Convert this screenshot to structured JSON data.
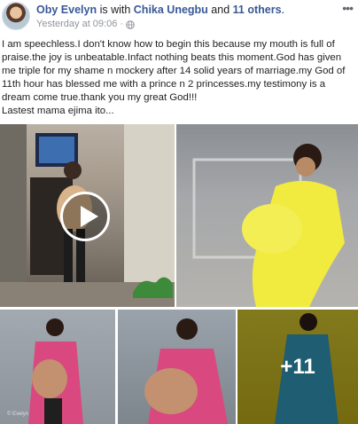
{
  "post": {
    "author": "Oby Evelyn",
    "with_text": " is with ",
    "tagged_name": "Chika Unegbu",
    "and_text": " and ",
    "others_text": "11 others",
    "period": ".",
    "timestamp": "Yesterday at 09:06",
    "dot": "·",
    "more_menu": "•••",
    "body_lines": [
      "I am speechless.I don't know how to begin this because my mouth is full of praise.the joy is unbeatable.Infact nothing beats this moment.God has given me triple for my shame n mockery after 14 solid years of marriage.my God of 11th hour has blessed me with a prince n 2 princesses.my testimony is a dream come true.thank you my great God!!!",
      "Lastest mama ejima ito..."
    ]
  },
  "media": {
    "more_count": "+11",
    "watermark": "© Evelyn"
  },
  "icons": {
    "globe": "globe-icon",
    "play": "play-icon",
    "more": "more-options-icon"
  }
}
